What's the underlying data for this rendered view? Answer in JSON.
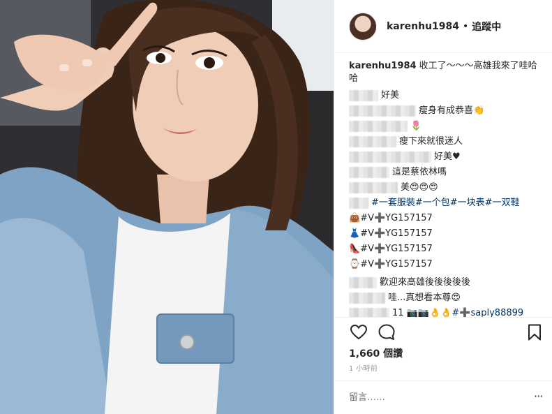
{
  "header": {
    "username": "karenhu1984",
    "separator": "•",
    "follow_status": "追蹤中"
  },
  "caption": {
    "username": "karenhu1984",
    "text": "收工了～～～高雄我來了哇哈哈"
  },
  "comments": [
    {
      "text": "好美",
      "tag": ""
    },
    {
      "text": "瘦身有成恭喜👏",
      "tag": ""
    },
    {
      "text": "🌷",
      "tag": ""
    },
    {
      "text": "瘦下來就很迷人",
      "tag": ""
    },
    {
      "text": "好美♥",
      "tag": ""
    },
    {
      "text": "這是蔡依林嗎",
      "tag": ""
    },
    {
      "text": "美😍😍😍",
      "tag": ""
    },
    {
      "text": "",
      "tag": "#一套服裝#一个包#一块表#一双鞋"
    },
    {
      "text": "👜#V➕YG157157",
      "tag": ""
    },
    {
      "text": "👗#V➕YG157157",
      "tag": ""
    },
    {
      "text": "👠#V➕YG157157",
      "tag": ""
    },
    {
      "text": "⌚#V➕YG157157",
      "tag": ""
    },
    {
      "text": "歡迎來高雄後後後後後",
      "tag": ""
    },
    {
      "text": "哇...真想看本尊😍",
      "tag": ""
    },
    {
      "text": "11 📷📷👌👌",
      "tag": "#➕saply88899"
    }
  ],
  "stats": {
    "likes": "1,660 個讚",
    "time": "1 小時前"
  },
  "comment_input": {
    "placeholder": "留言……",
    "more": "···"
  },
  "icons": {
    "like": "heart-icon",
    "comment": "comment-bubble-icon",
    "save": "bookmark-icon",
    "more": "more-options-icon"
  }
}
